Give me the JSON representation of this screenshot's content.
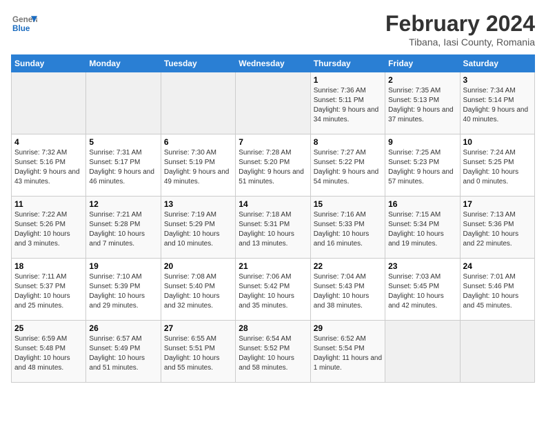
{
  "header": {
    "logo_general": "General",
    "logo_blue": "Blue",
    "title": "February 2024",
    "subtitle": "Tibana, Iasi County, Romania"
  },
  "calendar": {
    "days_of_week": [
      "Sunday",
      "Monday",
      "Tuesday",
      "Wednesday",
      "Thursday",
      "Friday",
      "Saturday"
    ],
    "weeks": [
      [
        {
          "day": "",
          "sunrise": "",
          "sunset": "",
          "daylight": ""
        },
        {
          "day": "",
          "sunrise": "",
          "sunset": "",
          "daylight": ""
        },
        {
          "day": "",
          "sunrise": "",
          "sunset": "",
          "daylight": ""
        },
        {
          "day": "",
          "sunrise": "",
          "sunset": "",
          "daylight": ""
        },
        {
          "day": "1",
          "sunrise": "Sunrise: 7:36 AM",
          "sunset": "Sunset: 5:11 PM",
          "daylight": "Daylight: 9 hours and 34 minutes."
        },
        {
          "day": "2",
          "sunrise": "Sunrise: 7:35 AM",
          "sunset": "Sunset: 5:13 PM",
          "daylight": "Daylight: 9 hours and 37 minutes."
        },
        {
          "day": "3",
          "sunrise": "Sunrise: 7:34 AM",
          "sunset": "Sunset: 5:14 PM",
          "daylight": "Daylight: 9 hours and 40 minutes."
        }
      ],
      [
        {
          "day": "4",
          "sunrise": "Sunrise: 7:32 AM",
          "sunset": "Sunset: 5:16 PM",
          "daylight": "Daylight: 9 hours and 43 minutes."
        },
        {
          "day": "5",
          "sunrise": "Sunrise: 7:31 AM",
          "sunset": "Sunset: 5:17 PM",
          "daylight": "Daylight: 9 hours and 46 minutes."
        },
        {
          "day": "6",
          "sunrise": "Sunrise: 7:30 AM",
          "sunset": "Sunset: 5:19 PM",
          "daylight": "Daylight: 9 hours and 49 minutes."
        },
        {
          "day": "7",
          "sunrise": "Sunrise: 7:28 AM",
          "sunset": "Sunset: 5:20 PM",
          "daylight": "Daylight: 9 hours and 51 minutes."
        },
        {
          "day": "8",
          "sunrise": "Sunrise: 7:27 AM",
          "sunset": "Sunset: 5:22 PM",
          "daylight": "Daylight: 9 hours and 54 minutes."
        },
        {
          "day": "9",
          "sunrise": "Sunrise: 7:25 AM",
          "sunset": "Sunset: 5:23 PM",
          "daylight": "Daylight: 9 hours and 57 minutes."
        },
        {
          "day": "10",
          "sunrise": "Sunrise: 7:24 AM",
          "sunset": "Sunset: 5:25 PM",
          "daylight": "Daylight: 10 hours and 0 minutes."
        }
      ],
      [
        {
          "day": "11",
          "sunrise": "Sunrise: 7:22 AM",
          "sunset": "Sunset: 5:26 PM",
          "daylight": "Daylight: 10 hours and 3 minutes."
        },
        {
          "day": "12",
          "sunrise": "Sunrise: 7:21 AM",
          "sunset": "Sunset: 5:28 PM",
          "daylight": "Daylight: 10 hours and 7 minutes."
        },
        {
          "day": "13",
          "sunrise": "Sunrise: 7:19 AM",
          "sunset": "Sunset: 5:29 PM",
          "daylight": "Daylight: 10 hours and 10 minutes."
        },
        {
          "day": "14",
          "sunrise": "Sunrise: 7:18 AM",
          "sunset": "Sunset: 5:31 PM",
          "daylight": "Daylight: 10 hours and 13 minutes."
        },
        {
          "day": "15",
          "sunrise": "Sunrise: 7:16 AM",
          "sunset": "Sunset: 5:33 PM",
          "daylight": "Daylight: 10 hours and 16 minutes."
        },
        {
          "day": "16",
          "sunrise": "Sunrise: 7:15 AM",
          "sunset": "Sunset: 5:34 PM",
          "daylight": "Daylight: 10 hours and 19 minutes."
        },
        {
          "day": "17",
          "sunrise": "Sunrise: 7:13 AM",
          "sunset": "Sunset: 5:36 PM",
          "daylight": "Daylight: 10 hours and 22 minutes."
        }
      ],
      [
        {
          "day": "18",
          "sunrise": "Sunrise: 7:11 AM",
          "sunset": "Sunset: 5:37 PM",
          "daylight": "Daylight: 10 hours and 25 minutes."
        },
        {
          "day": "19",
          "sunrise": "Sunrise: 7:10 AM",
          "sunset": "Sunset: 5:39 PM",
          "daylight": "Daylight: 10 hours and 29 minutes."
        },
        {
          "day": "20",
          "sunrise": "Sunrise: 7:08 AM",
          "sunset": "Sunset: 5:40 PM",
          "daylight": "Daylight: 10 hours and 32 minutes."
        },
        {
          "day": "21",
          "sunrise": "Sunrise: 7:06 AM",
          "sunset": "Sunset: 5:42 PM",
          "daylight": "Daylight: 10 hours and 35 minutes."
        },
        {
          "day": "22",
          "sunrise": "Sunrise: 7:04 AM",
          "sunset": "Sunset: 5:43 PM",
          "daylight": "Daylight: 10 hours and 38 minutes."
        },
        {
          "day": "23",
          "sunrise": "Sunrise: 7:03 AM",
          "sunset": "Sunset: 5:45 PM",
          "daylight": "Daylight: 10 hours and 42 minutes."
        },
        {
          "day": "24",
          "sunrise": "Sunrise: 7:01 AM",
          "sunset": "Sunset: 5:46 PM",
          "daylight": "Daylight: 10 hours and 45 minutes."
        }
      ],
      [
        {
          "day": "25",
          "sunrise": "Sunrise: 6:59 AM",
          "sunset": "Sunset: 5:48 PM",
          "daylight": "Daylight: 10 hours and 48 minutes."
        },
        {
          "day": "26",
          "sunrise": "Sunrise: 6:57 AM",
          "sunset": "Sunset: 5:49 PM",
          "daylight": "Daylight: 10 hours and 51 minutes."
        },
        {
          "day": "27",
          "sunrise": "Sunrise: 6:55 AM",
          "sunset": "Sunset: 5:51 PM",
          "daylight": "Daylight: 10 hours and 55 minutes."
        },
        {
          "day": "28",
          "sunrise": "Sunrise: 6:54 AM",
          "sunset": "Sunset: 5:52 PM",
          "daylight": "Daylight: 10 hours and 58 minutes."
        },
        {
          "day": "29",
          "sunrise": "Sunrise: 6:52 AM",
          "sunset": "Sunset: 5:54 PM",
          "daylight": "Daylight: 11 hours and 1 minute."
        },
        {
          "day": "",
          "sunrise": "",
          "sunset": "",
          "daylight": ""
        },
        {
          "day": "",
          "sunrise": "",
          "sunset": "",
          "daylight": ""
        }
      ]
    ]
  }
}
